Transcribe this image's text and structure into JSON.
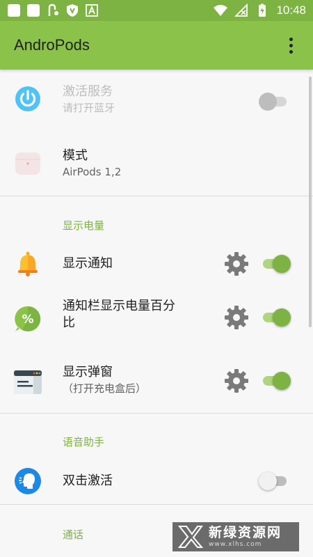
{
  "status_bar": {
    "time": "10:48"
  },
  "app_bar": {
    "title": "AndroPods"
  },
  "service": {
    "title": "激活服务",
    "summary": "请打开蓝牙",
    "enabled": false
  },
  "mode": {
    "title": "模式",
    "summary": "AirPods 1,2"
  },
  "battery_section": {
    "header": "显示电量",
    "show_notification": {
      "title": "显示通知",
      "enabled": true
    },
    "status_bar_percent": {
      "title_line1": "通知栏显示电量百分",
      "title_line2": "比",
      "enabled": true
    },
    "show_popup": {
      "title": "显示弹窗",
      "summary": "（打开充电盒后）",
      "enabled": true
    }
  },
  "voice_section": {
    "header": "语音助手",
    "double_tap": {
      "title": "双击激活",
      "enabled": false
    }
  },
  "call_section": {
    "header": "通话"
  },
  "watermark": {
    "name": "新绿资源网",
    "url": "www.xlhs.com"
  },
  "colors": {
    "accent": "#8bc34a",
    "accent_dark": "#7cb342",
    "background": "#f7f7f7"
  }
}
